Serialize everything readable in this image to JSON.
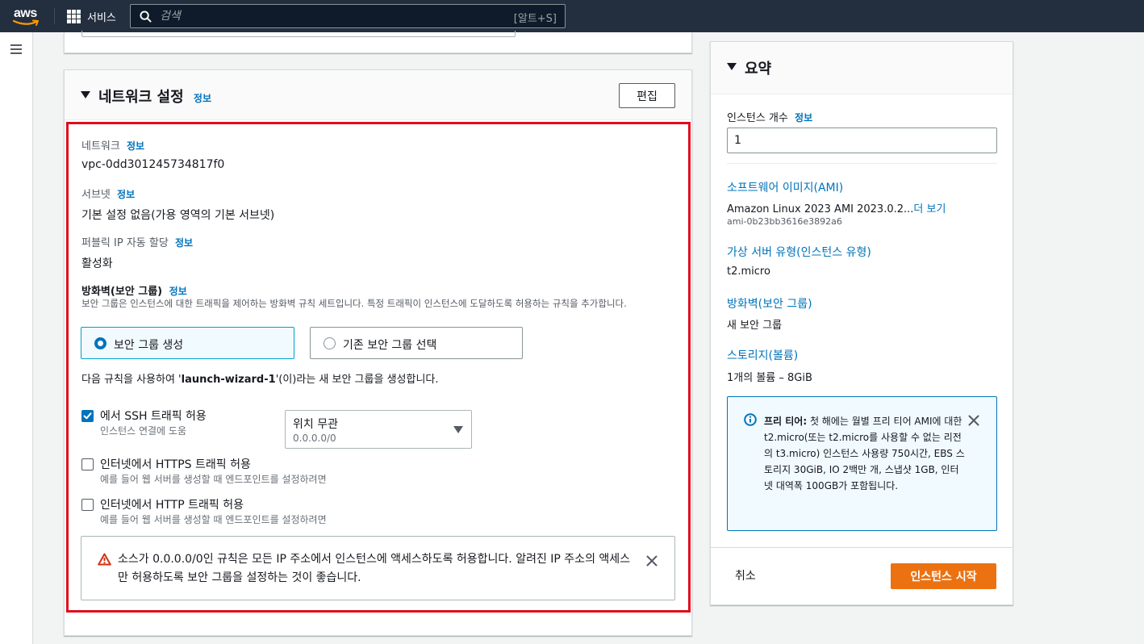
{
  "nav": {
    "logo": "aws",
    "services_label": "서비스",
    "search_placeholder": "검색",
    "search_shortcut": "[알트+S]"
  },
  "network": {
    "title": "네트워크 설정",
    "info": "정보",
    "edit_label": "편집",
    "network_label": "네트워크",
    "network_value": "vpc-0dd301245734817f0",
    "subnet_label": "서브넷",
    "subnet_value": "기본 설정 없음(가용 영역의 기본 서브넷)",
    "public_ip_label": "퍼블릭 IP 자동 할당",
    "public_ip_value": "활성화",
    "firewall_label": "방화벽(보안 그룹)",
    "firewall_desc": "보안 그룹은 인스턴스에 대한 트래픽을 제어하는 방화벽 규칙 세트입니다. 특정 트래픽이 인스턴스에 도달하도록 허용하는 규칙을 추가합니다.",
    "radio_create": "보안 그룹 생성",
    "radio_existing": "기존 보안 그룹 선택",
    "sg_sentence_prefix": "다음 규칙을 사용하여 '",
    "sg_name": "launch-wizard-1",
    "sg_sentence_suffix": "'(이)라는 새 보안 그룹을 생성합니다.",
    "rules": [
      {
        "label": "에서 SSH 트래픽 허용",
        "desc": "인스턴스 연결에 도움",
        "checked": true
      },
      {
        "label": "인터넷에서 HTTPS 트래픽 허용",
        "desc": "예를 들어 웹 서버를 생성할 때 엔드포인트를 설정하려면",
        "checked": false
      },
      {
        "label": "인터넷에서 HTTP 트래픽 허용",
        "desc": "예를 들어 웹 서버를 생성할 때 엔드포인트를 설정하려면",
        "checked": false
      }
    ],
    "source_select_value": "위치 무관",
    "source_select_sub": "0.0.0.0/0",
    "warning_text": "소스가 0.0.0.0/0인 규칙은 모든 IP 주소에서 인스턴스에 액세스하도록 허용합니다. 알려진 IP 주소의 액세스만 허용하도록 보안 그룹을 설정하는 것이 좋습니다."
  },
  "summary": {
    "title": "요약",
    "instance_count_label": "인스턴스 개수",
    "info": "정보",
    "instance_count_value": "1",
    "ami_label": "소프트웨어 이미지(AMI)",
    "ami_value": "Amazon Linux 2023 AMI 2023.0.2...",
    "ami_more": "더 보기",
    "ami_id": "ami-0b23bb3616e3892a6",
    "type_label": "가상 서버 유형(인스턴스 유형)",
    "type_value": "t2.micro",
    "firewall_label": "방화벽(보안 그룹)",
    "firewall_value": "새 보안 그룹",
    "storage_label": "스토리지(볼륨)",
    "storage_value": "1개의 볼륨 – 8GiB",
    "free_tier_bold": "프리 티어:",
    "free_tier_text": " 첫 해에는 월별 프리 티어 AMI에 대한 t2.micro(또는 t2.micro를 사용할 수 없는 리전의 t3.micro) 인스턴스 사용량 750시간, EBS 스토리지 30GiB, IO 2백만 개, 스냅샷 1GB, 인터넷 대역폭 100GB가 포함됩니다.",
    "cancel_label": "취소",
    "launch_label": "인스턴스 시작"
  },
  "colors": {
    "nav_bg": "#232f3e",
    "link": "#0073bb",
    "primary": "#ec7211",
    "highlight": "#e00d1d",
    "warning": "#d13212"
  }
}
